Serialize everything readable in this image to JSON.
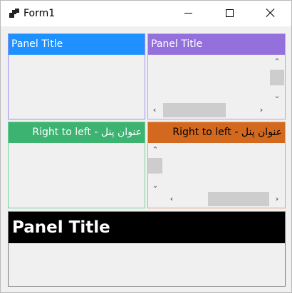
{
  "window": {
    "title": "Form1",
    "icon": "form-app-icon"
  },
  "controls": {
    "minimize": "minimize-icon",
    "maximize": "maximize-icon",
    "close": "close-icon"
  },
  "panels": [
    {
      "title": "Panel Title",
      "color": "#1e90ff",
      "border": "#9a8ff5",
      "direction": "ltr",
      "scrollbars": false
    },
    {
      "title": "Panel Title",
      "color": "#9370db",
      "border": "#b9a3e3",
      "direction": "ltr",
      "scrollbars": true
    },
    {
      "title": "عنوان پنل - Right to left",
      "color": "#3cb371",
      "border": "#76cf98",
      "direction": "rtl",
      "scrollbars": false
    },
    {
      "title": "عنوان پنل - Right to left",
      "color": "#d2691e",
      "border": "#e4a27c",
      "direction": "rtl",
      "scrollbars": true
    },
    {
      "title": "Panel Title",
      "color": "#000000",
      "border": "#555555",
      "direction": "ltr",
      "scrollbars": false
    }
  ]
}
